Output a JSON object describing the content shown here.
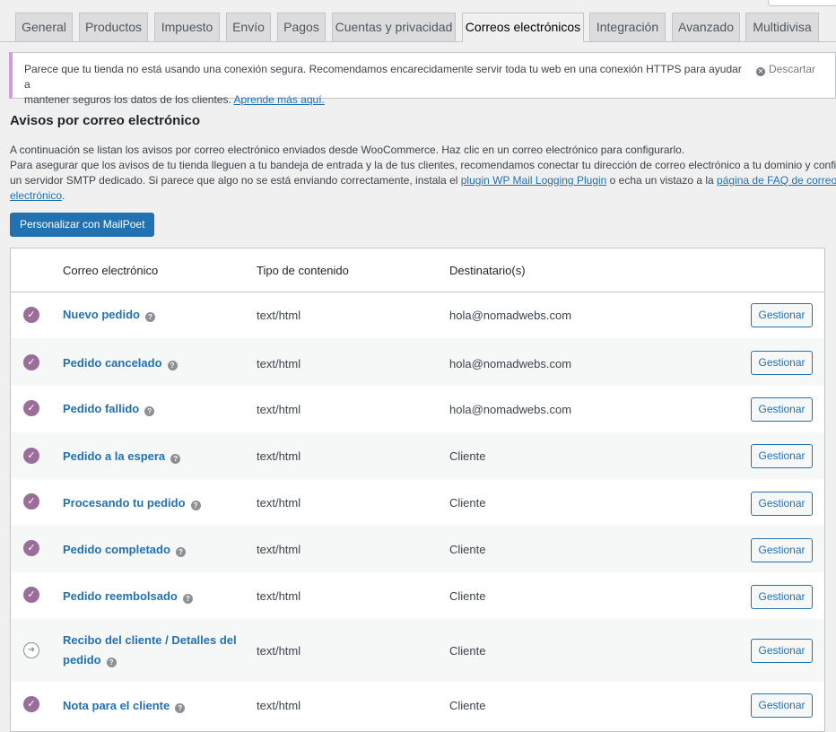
{
  "tabs": [
    {
      "label": "General",
      "active": false
    },
    {
      "label": "Productos",
      "active": false
    },
    {
      "label": "Impuesto",
      "active": false
    },
    {
      "label": "Envío",
      "active": false
    },
    {
      "label": "Pagos",
      "active": false
    },
    {
      "label": "Cuentas y privacidad",
      "active": false
    },
    {
      "label": "Correos electrónicos",
      "active": true
    },
    {
      "label": "Integración",
      "active": false
    },
    {
      "label": "Avanzado",
      "active": false
    },
    {
      "label": "Multidivisa",
      "active": false
    }
  ],
  "notice": {
    "text_line1": "Parece que tu tienda no está usando una conexión segura. Recomendamos encarecidamente servir toda tu web en una conexión HTTPS para ayudar a",
    "text_line2": "mantener seguros los datos de los clientes. ",
    "link": "Aprende más aquí.",
    "dismiss": "Descartar"
  },
  "section": {
    "title": "Avisos por correo electrónico",
    "line1": "A continuación se listan los avisos por correo electrónico enviados desde WooCommerce. Haz clic en un correo electrónico para configurarlo.",
    "line2": "Para asegurar que los avisos de tu tienda lleguen a tu bandeja de entrada y la de tus clientes, recomendamos conectar tu dirección de correo electrónico a tu dominio y configurar",
    "line3_a": "un servidor SMTP dedicado. Si parece que algo no se está enviando correctamente, instala el ",
    "link_plugin": "plugin WP Mail Logging Plugin",
    "line3_b": " o echa un vistazo a la ",
    "link_faq_1": "página de FAQ de correo",
    "link_faq_2": "electrónico",
    "line3_end": ".",
    "mailpoet_button": "Personalizar con MailPoet"
  },
  "table": {
    "headers": {
      "email": "Correo electrónico",
      "content_type": "Tipo de contenido",
      "recipients": "Destinatario(s)"
    },
    "rows": [
      {
        "name": "Nuevo pedido",
        "content_type": "text/html",
        "recipient": "hola@nomadwebs.com",
        "action": "Gestionar"
      },
      {
        "name": "Pedido cancelado",
        "content_type": "text/html",
        "recipient": "hola@nomadwebs.com",
        "action": "Gestionar"
      },
      {
        "name": "Pedido fallido",
        "content_type": "text/html",
        "recipient": "hola@nomadwebs.com",
        "action": "Gestionar"
      },
      {
        "name": "Pedido a la espera",
        "content_type": "text/html",
        "recipient": "Cliente",
        "action": "Gestionar"
      },
      {
        "name": "Procesando tu pedido",
        "content_type": "text/html",
        "recipient": "Cliente",
        "action": "Gestionar"
      },
      {
        "name": "Pedido completado",
        "content_type": "text/html",
        "recipient": "Cliente",
        "action": "Gestionar"
      },
      {
        "name": "Pedido reembolsado",
        "content_type": "text/html",
        "recipient": "Cliente",
        "action": "Gestionar"
      },
      {
        "name_line1": "Recibo del cliente / Detalles del",
        "name_line2": "pedido",
        "content_type": "text/html",
        "recipient": "Cliente",
        "action": "Gestionar"
      },
      {
        "name": "Nota para el cliente",
        "content_type": "text/html",
        "recipient": "Cliente",
        "action": "Gestionar"
      }
    ]
  },
  "colors": {
    "accent": "#2271b1",
    "status_enabled": "#9b6e9a",
    "notice_border": "#c9a0dc"
  }
}
